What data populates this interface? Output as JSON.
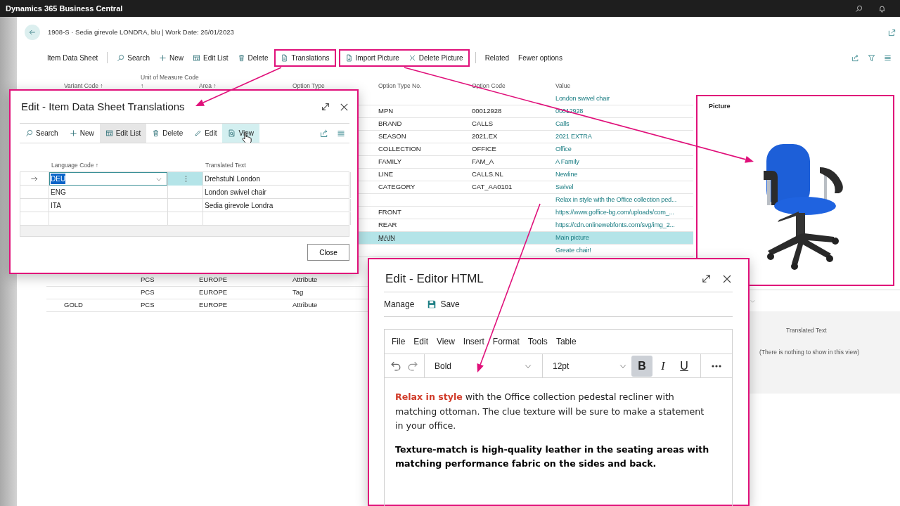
{
  "app_bar": {
    "title": "Dynamics 365 Business Central"
  },
  "page": {
    "title": "1908-S · Sedia girevole LONDRA, blu | Work Date: 26/01/2023"
  },
  "action_bar": [
    {
      "framed": false,
      "divider_after": true,
      "items": [
        {
          "label": "Item Data Sheet",
          "kind": "caption"
        }
      ]
    },
    {
      "framed": false,
      "divider_after": false,
      "items": [
        {
          "label": "Search",
          "kind": "search"
        },
        {
          "label": "New",
          "kind": "new"
        },
        {
          "label": "Edit List",
          "kind": "edit_list"
        },
        {
          "label": "Delete",
          "kind": "delete"
        }
      ]
    },
    {
      "framed": true,
      "divider_after": false,
      "items": [
        {
          "label": "Translations",
          "kind": "translations"
        }
      ]
    },
    {
      "framed": true,
      "divider_after": true,
      "items": [
        {
          "label": "Import Picture",
          "kind": "import"
        },
        {
          "label": "Delete Picture",
          "kind": "remove"
        }
      ]
    },
    {
      "framed": false,
      "divider_after": false,
      "items": [
        {
          "label": "Related",
          "kind": "plain"
        },
        {
          "label": "Fewer options",
          "kind": "plain"
        }
      ]
    }
  ],
  "table": {
    "columns": [
      "Variant Code ↑",
      "Unit of Measure Code ↑",
      "Area ↑",
      "Option Type",
      "Option Type No.",
      "Option Code",
      "Value"
    ],
    "rows": [
      {
        "value": "London swivel chair",
        "selected": false
      },
      {
        "option_type_no": "MPN",
        "option_code": "00012928",
        "value": "00012928",
        "selected": false
      },
      {
        "option_type_no": "BRAND",
        "option_code": "CALLS",
        "value": "Calls",
        "selected": false
      },
      {
        "option_type_no": "SEASON",
        "option_code": "2021.EX",
        "value": "2021 EXTRA",
        "selected": false
      },
      {
        "option_type_no": "COLLECTION",
        "option_code": "OFFICE",
        "value": "Office",
        "selected": false
      },
      {
        "option_type_no": "FAMILY",
        "option_code": "FAM_A",
        "value": "A Family",
        "selected": false
      },
      {
        "option_type_no": "LINE",
        "option_code": "CALLS.NL",
        "value": "Newline",
        "selected": false
      },
      {
        "option_type_no": "CATEGORY",
        "option_code": "CAT_AA0101",
        "value": "Swivel",
        "selected": false
      },
      {
        "value": "Relax in style with the Office collection ped...",
        "selected": false
      },
      {
        "option_type_no": "FRONT",
        "value": "https://www.goffice-bg.com/uploads/com_...",
        "selected": false
      },
      {
        "option_type_no": "REAR",
        "value": "https://cdn.onlinewebfonts.com/svg/img_2...",
        "selected": false
      },
      {
        "option_type_no": "MAIN",
        "value": "Main picture",
        "selected": true
      },
      {
        "value": "Greate chair!",
        "selected": false
      }
    ],
    "lower_rows": [
      {
        "unit_of_measure_code": "PCS",
        "area": "EUROPE",
        "option_type": "Attribute",
        "selected": false
      },
      {
        "unit_of_measure_code": "PCS",
        "area": "EUROPE",
        "option_type": "Tag",
        "selected": false
      },
      {
        "variant_code": "GOLD",
        "unit_of_measure_code": "PCS",
        "area": "EUROPE",
        "option_type": "Attribute",
        "selected": false
      }
    ]
  },
  "picture_part": {
    "title": "Picture"
  },
  "translations_part": {
    "columns": [
      "Translated Text"
    ],
    "empty_text": "(There is nothing to show in this view)"
  },
  "translations_dialog": {
    "title": "Edit - Item Data Sheet Translations",
    "toolbar": [
      {
        "label": "Search",
        "kind": "search",
        "pressed": false,
        "hovered": false
      },
      {
        "label": "New",
        "kind": "new",
        "pressed": false,
        "hovered": false
      },
      {
        "label": "Edit List",
        "kind": "edit_list",
        "pressed": true,
        "hovered": false
      },
      {
        "label": "Delete",
        "kind": "delete",
        "pressed": false,
        "hovered": false
      },
      {
        "label": "Edit",
        "kind": "edit",
        "pressed": false,
        "hovered": false
      },
      {
        "label": "View",
        "kind": "view",
        "pressed": false,
        "hovered": true
      }
    ],
    "columns": [
      "Language Code ↑",
      "Translated Text"
    ],
    "rows": [
      {
        "language_code": "DEU",
        "translated_text": "Drehstuhl London",
        "selected": true
      },
      {
        "language_code": "ENG",
        "translated_text": "London swivel chair",
        "selected": false
      },
      {
        "language_code": "ITA",
        "translated_text": "Sedia girevole Londra",
        "selected": false
      }
    ],
    "close_button": "Close"
  },
  "editor_dialog": {
    "title": "Edit - Editor HTML",
    "actions": [
      {
        "label": "Manage",
        "kind": "plain"
      },
      {
        "label": "Save",
        "kind": "save"
      }
    ],
    "menu": [
      "File",
      "Edit",
      "View",
      "Insert",
      "Format",
      "Tools",
      "Table"
    ],
    "block_format": "Bold",
    "font_size": "12pt",
    "format_buttons": [
      {
        "label": "B",
        "kind": "bold",
        "active": true
      },
      {
        "label": "I",
        "kind": "italic",
        "active": false
      },
      {
        "label": "U",
        "kind": "underline",
        "active": false
      }
    ],
    "paragraphs": [
      {
        "text": "**Relax in style** with the Office collection pedestal recliner with matching ottoman. The clue texture will be sure to make a statement in your office.",
        "kind": "normal"
      },
      {
        "text": "Texture-match is high-quality leather in the seating areas with matching performance fabric on the sides and back.",
        "kind": "bold"
      }
    ]
  }
}
